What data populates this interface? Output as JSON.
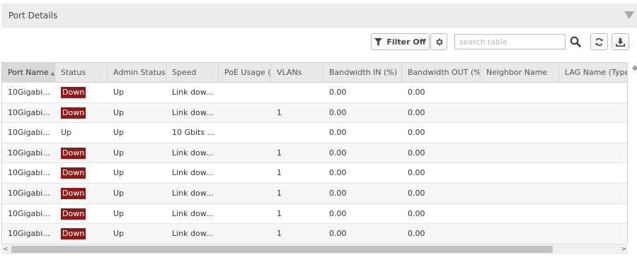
{
  "panel": {
    "title": "Port Details"
  },
  "toolbar": {
    "filter_label": "Filter Off",
    "search_placeholder": "search table"
  },
  "table": {
    "columns": [
      "Port Name",
      "Status",
      "Admin Status",
      "Speed",
      "PoE Usage (u",
      "VLANs",
      "Bandwidth IN (%)",
      "Bandwidth OUT (%)",
      "Neighbor Name",
      "LAG Name (Type)"
    ],
    "sorted_column": "Port Name",
    "rows": [
      {
        "port_name": "10Gigabi...",
        "status": "Down",
        "admin_status": "Up",
        "speed": "Link dow...",
        "poe": "",
        "vlans": "",
        "bw_in": "0.00",
        "bw_out": "0.00",
        "neighbor": "",
        "lag": ""
      },
      {
        "port_name": "10Gigabi...",
        "status": "Down",
        "admin_status": "Up",
        "speed": "Link dow...",
        "poe": "",
        "vlans": "1",
        "bw_in": "0.00",
        "bw_out": "0.00",
        "neighbor": "",
        "lag": ""
      },
      {
        "port_name": "10Gigabi...",
        "status": "Up",
        "admin_status": "Up",
        "speed": "10 Gbits ...",
        "poe": "",
        "vlans": "",
        "bw_in": "0.00",
        "bw_out": "0.00",
        "neighbor": "",
        "lag": ""
      },
      {
        "port_name": "10Gigabi...",
        "status": "Down",
        "admin_status": "Up",
        "speed": "Link dow...",
        "poe": "",
        "vlans": "1",
        "bw_in": "0.00",
        "bw_out": "0.00",
        "neighbor": "",
        "lag": ""
      },
      {
        "port_name": "10Gigabi...",
        "status": "Down",
        "admin_status": "Up",
        "speed": "Link dow...",
        "poe": "",
        "vlans": "1",
        "bw_in": "0.00",
        "bw_out": "0.00",
        "neighbor": "",
        "lag": ""
      },
      {
        "port_name": "10Gigabi...",
        "status": "Down",
        "admin_status": "Up",
        "speed": "Link dow...",
        "poe": "",
        "vlans": "1",
        "bw_in": "0.00",
        "bw_out": "0.00",
        "neighbor": "",
        "lag": ""
      },
      {
        "port_name": "10Gigabi...",
        "status": "Down",
        "admin_status": "Up",
        "speed": "Link dow...",
        "poe": "",
        "vlans": "1",
        "bw_in": "0.00",
        "bw_out": "0.00",
        "neighbor": "",
        "lag": ""
      },
      {
        "port_name": "10Gigabi...",
        "status": "Down",
        "admin_status": "Up",
        "speed": "Link dow...",
        "poe": "",
        "vlans": "1",
        "bw_in": "0.00",
        "bw_out": "0.00",
        "neighbor": "",
        "lag": ""
      }
    ]
  },
  "colors": {
    "status_down_bg": "#8b1a1a",
    "header_bg": "#ececec"
  },
  "icons": [
    "collapse-triangle-icon",
    "filter-funnel-icon",
    "gear-icon",
    "search-icon",
    "refresh-icon",
    "download-icon",
    "column-settings-icon"
  ]
}
